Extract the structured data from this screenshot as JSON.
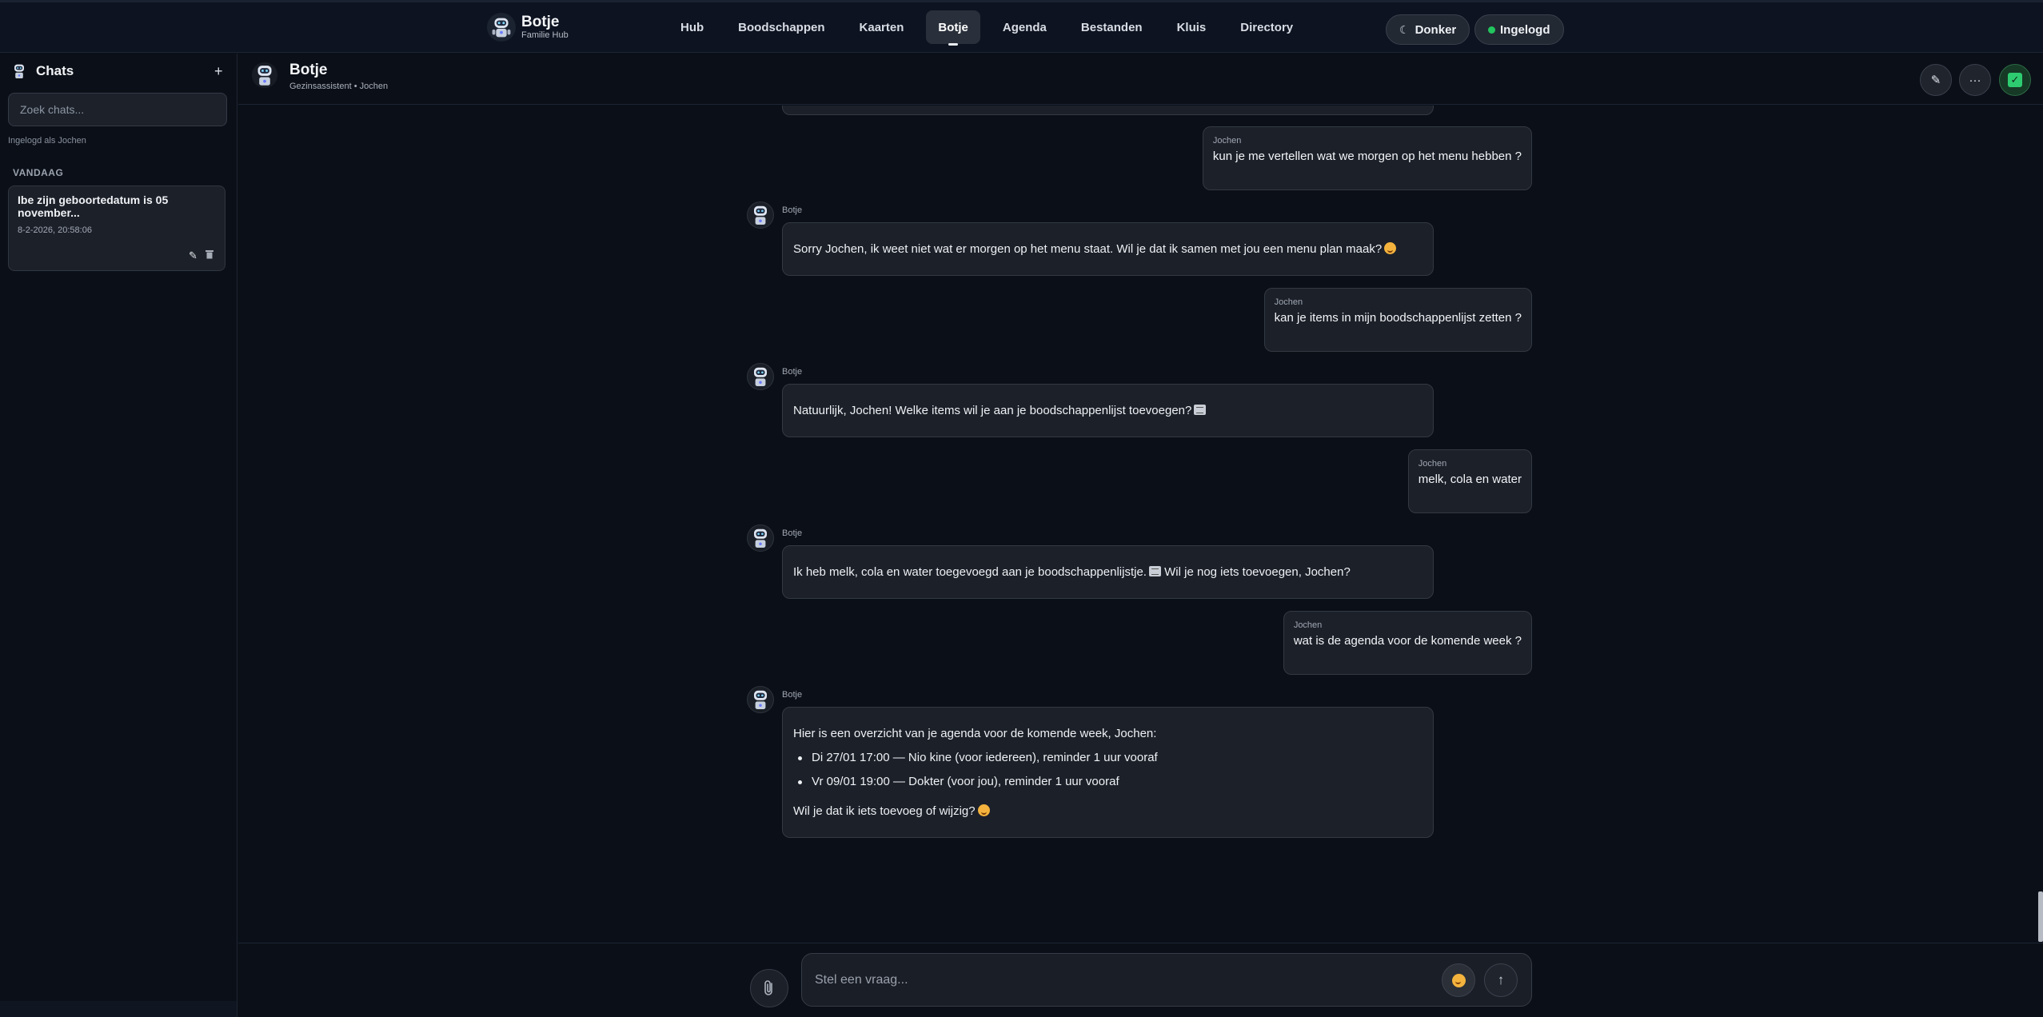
{
  "app": {
    "title": "Botje",
    "subtitle": "Familie Hub"
  },
  "nav": {
    "items": [
      "Hub",
      "Boodschappen",
      "Kaarten",
      "Botje",
      "Agenda",
      "Bestanden",
      "Kluis",
      "Directory"
    ],
    "active": "Botje"
  },
  "header_actions": {
    "theme_label": "Donker",
    "status_label": "Ingelogd",
    "status_color": "#22c55e"
  },
  "sidebar": {
    "title": "Chats",
    "add_icon": "plus-icon",
    "search_placeholder": "Zoek chats...",
    "logged_in_text": "Ingelogd als Jochen",
    "group_label": "VANDAAG",
    "chats": [
      {
        "title": "Ibe zijn geboortedatum is 05 november...",
        "date": "8-2-2026, 20:58:06",
        "edit_icon": "pencil-icon",
        "delete_icon": "trash-icon"
      }
    ]
  },
  "chat_header": {
    "title": "Botje",
    "subtitle": "Gezinsassistent • Jochen",
    "actions": [
      "pencil-icon",
      "more-icon",
      "check-icon"
    ]
  },
  "messages": [
    {
      "role": "user",
      "author": "Jochen",
      "text": "kun je me vertellen wat we morgen op het menu hebben ?"
    },
    {
      "role": "bot",
      "author": "Botje",
      "text": "Sorry Jochen, ik weet niet wat er morgen op het menu staat. Wil je dat ik samen met jou een menu plan maak?",
      "emoji": "smile-emoji"
    },
    {
      "role": "user",
      "author": "Jochen",
      "text": "kan je items in mijn boodschappenlijst zetten ?"
    },
    {
      "role": "bot",
      "author": "Botje",
      "text": "Natuurlijk, Jochen! Welke items wil je aan je boodschappenlijst toevoegen?",
      "emoji": "memo-emoji"
    },
    {
      "role": "user",
      "author": "Jochen",
      "text": "melk, cola en water"
    },
    {
      "role": "bot",
      "author": "Botje",
      "text": "Ik heb melk, cola en water toegevoegd aan je boodschappenlijstje.",
      "emoji": "memo-emoji",
      "text_after": "Wil je nog iets toevoegen, Jochen?"
    },
    {
      "role": "user",
      "author": "Jochen",
      "text": "wat is de agenda voor de komende week ?"
    },
    {
      "role": "bot",
      "author": "Botje",
      "intro": "Hier is een overzicht van je agenda voor de komende week, Jochen:",
      "bullets": [
        "Di 27/01 17:00 — Nio kine (voor iedereen), reminder 1 uur vooraf",
        "Vr 09/01 19:00 — Dokter (voor jou), reminder 1 uur vooraf"
      ],
      "outro": "Wil je dat ik iets toevoeg of wijzig?",
      "emoji": "smile-emoji"
    }
  ],
  "composer": {
    "placeholder": "Stel een vraag...",
    "attach_icon": "paperclip-icon",
    "emoji_icon": "smile-emoji",
    "send_icon": "arrow-up-icon"
  }
}
